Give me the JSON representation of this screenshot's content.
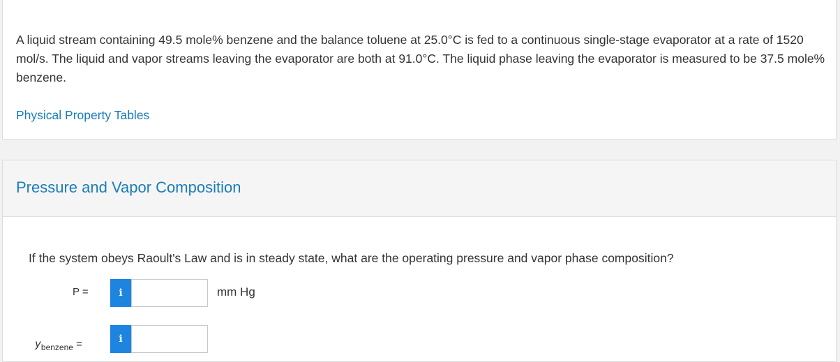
{
  "problem": {
    "text": "A liquid stream containing 49.5 mole% benzene and the balance toluene at 25.0°C is fed to a continuous single-stage evaporator at a rate of 1520 mol/s. The liquid and vapor streams leaving the evaporator are both at 91.0°C. The liquid phase leaving the evaporator is measured to be 37.5 mole% benzene.",
    "link_label": "Physical Property Tables"
  },
  "section": {
    "title": "Pressure and Vapor Composition",
    "question": "If the system obeys Raoult's Law and is in steady state, what are the operating pressure and vapor phase composition?"
  },
  "inputs": {
    "pressure": {
      "label": "P =",
      "info_icon": "i",
      "value": "",
      "unit": "mm Hg"
    },
    "y_benzene": {
      "label_var": "y",
      "label_sub": "benzene",
      "label_eq": "=",
      "info_icon": "i",
      "value": ""
    }
  },
  "colors": {
    "link": "#1a7cb9",
    "info_button": "#1d85e0",
    "header_bg": "#f5f5f5"
  }
}
